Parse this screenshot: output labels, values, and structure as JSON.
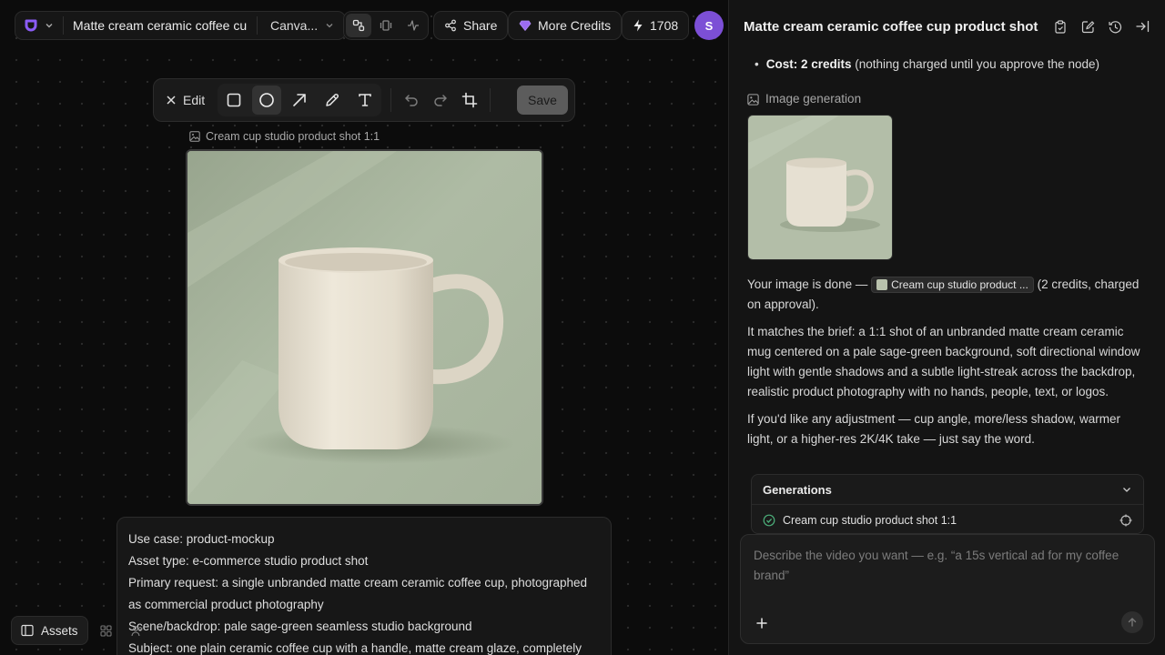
{
  "topbar": {
    "project_title": "Matte cream ceramic coffee cup",
    "canvas_label": "Canva...",
    "share_label": "Share",
    "credits_label": "More Credits",
    "balance": "1708",
    "avatar_initial": "S"
  },
  "toolbar": {
    "edit_label": "Edit",
    "save_label": "Save"
  },
  "node": {
    "label": "Cream cup studio product shot 1:1"
  },
  "prompt_lines": [
    "Use case: product-mockup",
    "Asset type: e-commerce studio product shot",
    "Primary request: a single unbranded matte cream ceramic coffee cup, photographed",
    "as commercial product photography",
    "Scene/backdrop: pale sage-green seamless studio background",
    "Subject: one plain ceramic coffee cup with a handle, matte cream glaze, completely"
  ],
  "bottom": {
    "assets_label": "Assets"
  },
  "panel": {
    "title": "Matte cream ceramic coffee cup product shot",
    "cost_label": "Cost: 2 credits",
    "cost_note": "(nothing charged until you approve the node)",
    "gen_label": "Image generation",
    "done_prefix": "Your image is done —",
    "chip_label": "Cream cup studio product ...",
    "done_suffix": "(2 credits, charged on approval).",
    "para_brief": "It matches the brief: a 1:1 shot of an unbranded matte cream ceramic mug centered on a pale sage-green background, soft directional window light with gentle shadows and a subtle light-streak across the backdrop, realistic product photography with no hands, people, text, or logos.",
    "para_adjust": "If you'd like any adjustment — cup angle, more/less shadow, warmer light, or a higher-res 2K/4K take — just say the word.",
    "generations_title": "Generations",
    "generation_item": "Cream cup studio product shot 1:1",
    "composer_placeholder": "Describe the video you want — e.g. “a 15s vertical ad for my coffee brand”"
  },
  "colors": {
    "accent_purple": "#7c4fd6",
    "sage_background": "#aab69f",
    "cup_cream": "#ebe4d6"
  }
}
